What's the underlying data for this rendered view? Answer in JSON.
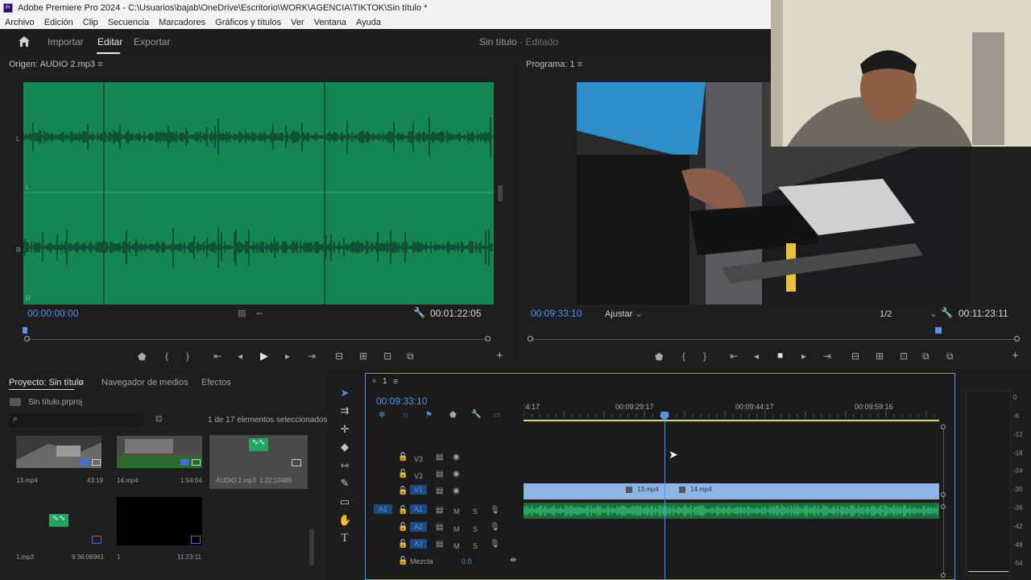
{
  "window": {
    "title": "Adobe Premiere Pro 2024 - C:\\Usuarios\\bajab\\OneDrive\\Escritorio\\WORK\\AGENCIA\\TIKTOK\\Sin título *",
    "logo": "Pr"
  },
  "menu": [
    "Archivo",
    "Edición",
    "Clip",
    "Secuencia",
    "Marcadores",
    "Gráficos y títulos",
    "Ver",
    "Ventana",
    "Ayuda"
  ],
  "workspace": {
    "tabs": [
      "Importar",
      "Editar",
      "Exportar"
    ],
    "active_tab": "Editar",
    "doc_title": "Sin título",
    "doc_status": "- Editado"
  },
  "source": {
    "title": "Origen: AUDIO 2.mp3",
    "timecode_in": "00:00:00:00",
    "duration": "00:01:22:05",
    "channel_labels": [
      "L",
      "L",
      "R",
      "R"
    ]
  },
  "program": {
    "title": "Programa: 1",
    "timecode": "00:09:33:10",
    "fit": "Ajustar",
    "resolution": "1/2",
    "duration": "00:11:23:11"
  },
  "project": {
    "tabs": [
      "Proyecto: Sin título",
      "Navegador de medios",
      "Efectos"
    ],
    "file": "Sin título.prproj",
    "selection_status": "1 de 17 elementos seleccionados",
    "items": [
      {
        "name": "13.mp4",
        "duration": "43:19"
      },
      {
        "name": "14.mp4",
        "duration": "1:54:04"
      },
      {
        "name": "AUDIO 2.mp3",
        "duration": "1:22:10489"
      },
      {
        "name": "1.mp3",
        "duration": "9:36:06961"
      },
      {
        "name": "1",
        "duration": "11:23:11"
      }
    ]
  },
  "timeline": {
    "tab": "1",
    "timecode": "00:09:33:10",
    "ruler_labels": [
      ":4:17",
      "00:09:29:17",
      "00:09:44:17",
      "00:09:59:16"
    ],
    "video_tracks": [
      "V3",
      "V2",
      "V1"
    ],
    "audio_tracks": [
      "A1",
      "A2",
      "A3"
    ],
    "source_patch": "A1",
    "mute_label": "M",
    "solo_label": "S",
    "mix_label": "Mezcla",
    "mix_value": "0.0",
    "clips": [
      "13.mp4",
      "14.mp4"
    ],
    "playhead_fraction": 0.34
  },
  "meter": {
    "labels": [
      "0",
      "-6",
      "-12",
      "-18",
      "-24",
      "-30",
      "-36",
      "-42",
      "-48",
      "-54"
    ]
  },
  "colors": {
    "accent_blue": "#4f95ee",
    "audio_green": "#148654",
    "clip_blue": "#8eb4e6",
    "timeline_audio": "#22a560"
  }
}
